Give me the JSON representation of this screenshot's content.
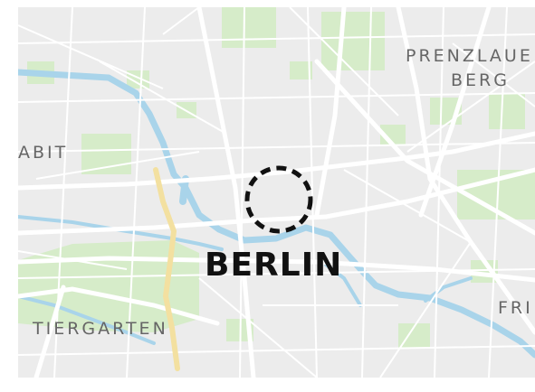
{
  "map": {
    "city_label": "BERLIN",
    "districts": {
      "prenzlauer_line1": "PRENZLAUE",
      "prenzlauer_line2": "BERG",
      "moabit": "ABIT",
      "tiergarten": "TIERGARTEN",
      "friedrichshain": "FRI"
    },
    "colors": {
      "background": "#ececec",
      "park": "#d6ecc9",
      "water": "#a9d4ea",
      "road": "#ffffff",
      "highway": "#f3e0a0",
      "marker": "#111111"
    },
    "marker": "dashed-circle-location-marker"
  }
}
